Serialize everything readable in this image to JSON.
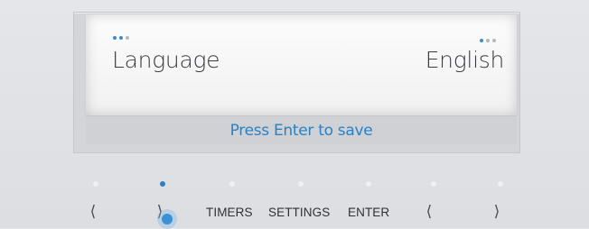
{
  "display": {
    "setting_label": "Language",
    "setting_value": "English",
    "hint": "Press Enter to save",
    "left_dots": [
      "active",
      "active",
      "inactive"
    ],
    "right_dots": [
      "active",
      "inactive",
      "inactive"
    ]
  },
  "controls": {
    "prev_symbol": "⟨",
    "next_symbol": "⟩",
    "timers_label": "TIMERS",
    "settings_label": "SETTINGS",
    "enter_label": "ENTER",
    "left_symbol": "⟨",
    "right_symbol": "⟩"
  },
  "indicators": [
    "off",
    "on",
    "off",
    "off",
    "off",
    "off",
    "off"
  ],
  "colors": {
    "accent": "#2a7fc6",
    "hint_text": "#2a81c4"
  }
}
